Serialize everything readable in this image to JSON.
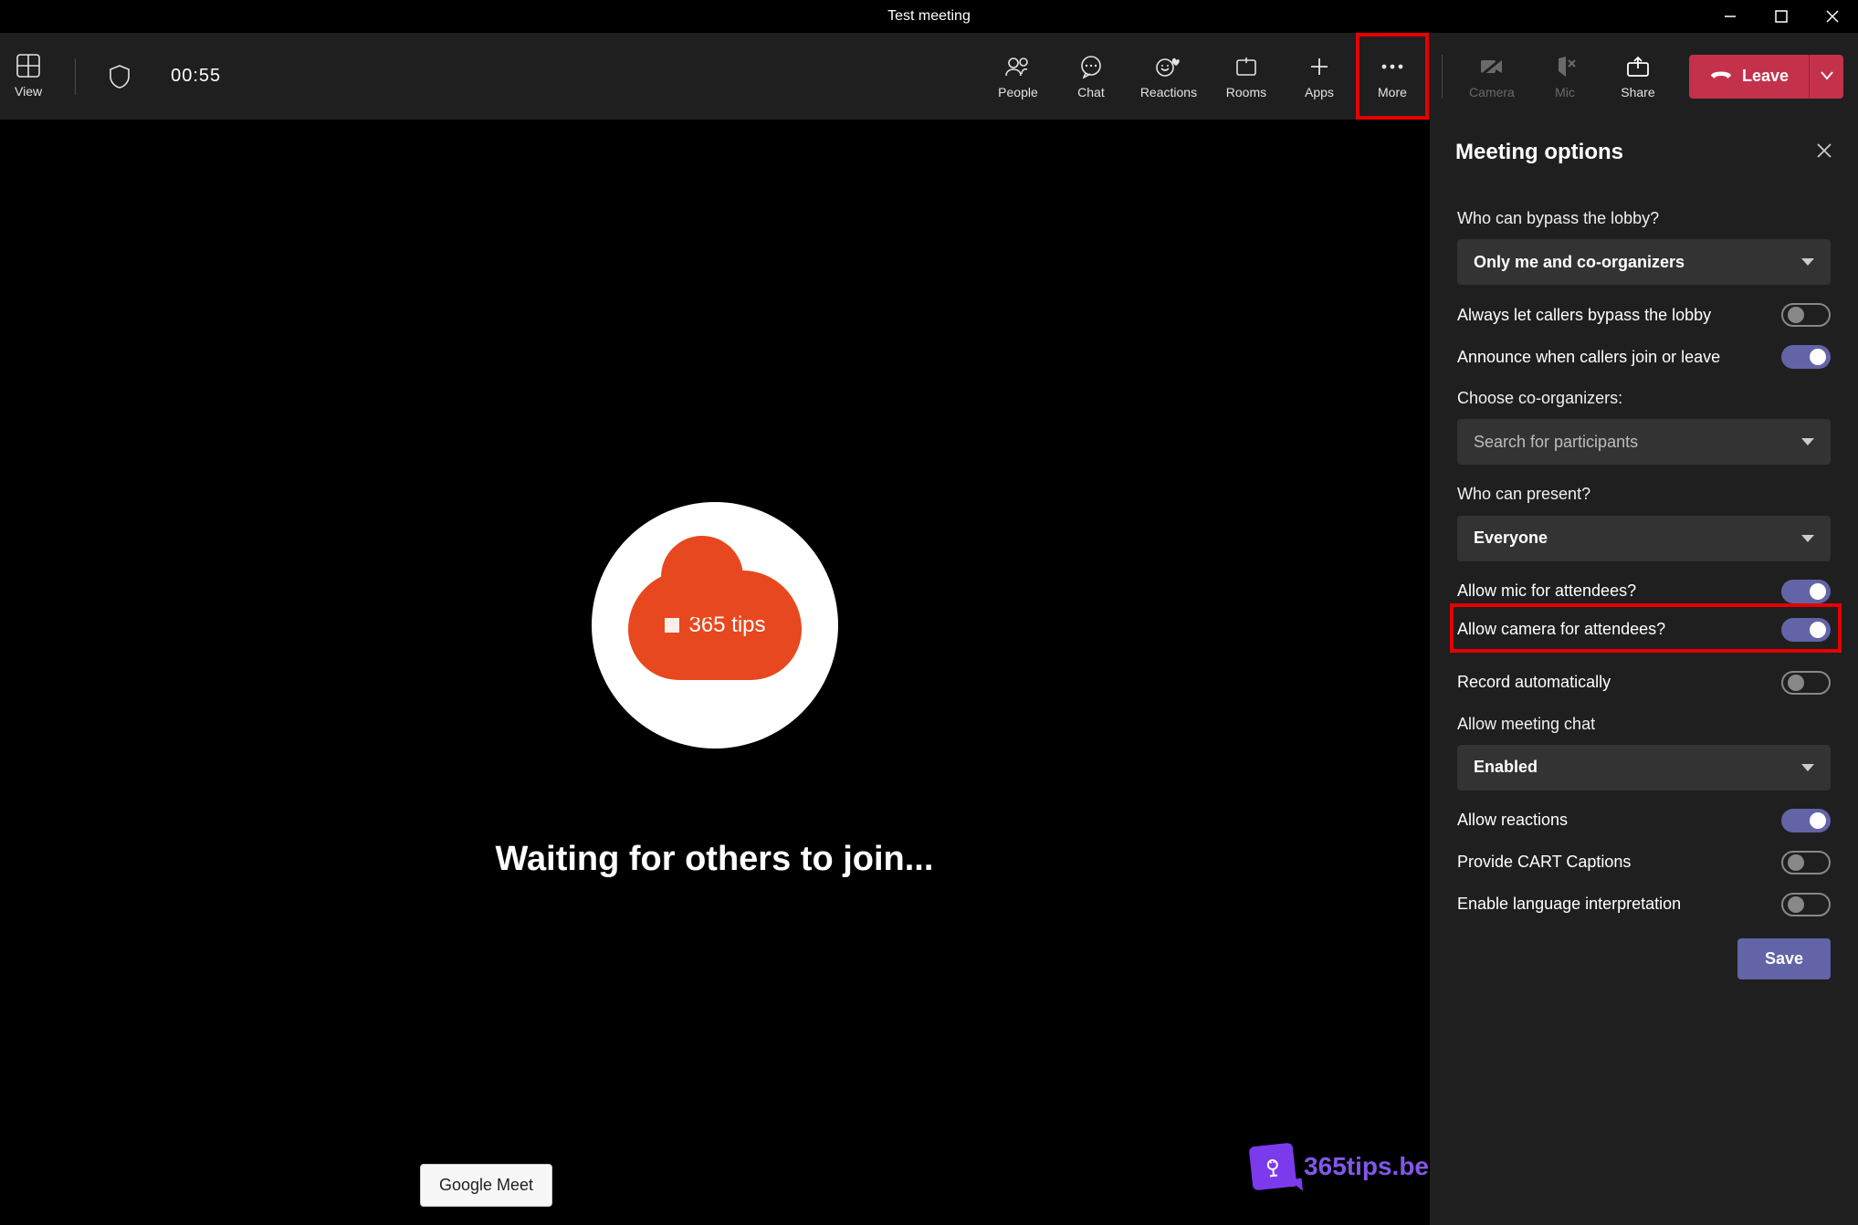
{
  "window": {
    "title": "Test meeting"
  },
  "topbar": {
    "view": "View",
    "timer": "00:55",
    "tools": {
      "people": "People",
      "chat": "Chat",
      "reactions": "Reactions",
      "rooms": "Rooms",
      "apps": "Apps",
      "more": "More",
      "camera": "Camera",
      "mic": "Mic",
      "share": "Share"
    },
    "leave": "Leave"
  },
  "stage": {
    "avatar_text": "365 tips",
    "waiting": "Waiting for others to join...",
    "google_meet": "Google Meet"
  },
  "panel": {
    "title": "Meeting options",
    "lobby_label": "Who can bypass the lobby?",
    "lobby_value": "Only me and co-organizers",
    "callers_bypass": {
      "label": "Always let callers bypass the lobby",
      "on": false
    },
    "announce": {
      "label": "Announce when callers join or leave",
      "on": true
    },
    "coorganizers_label": "Choose co-organizers:",
    "coorganizers_placeholder": "Search for participants",
    "present_label": "Who can present?",
    "present_value": "Everyone",
    "allow_mic": {
      "label": "Allow mic for attendees?",
      "on": true
    },
    "allow_cam": {
      "label": "Allow camera for attendees?",
      "on": true
    },
    "record_auto": {
      "label": "Record automatically",
      "on": false
    },
    "chat_label": "Allow meeting chat",
    "chat_value": "Enabled",
    "allow_reactions": {
      "label": "Allow reactions",
      "on": true
    },
    "cart": {
      "label": "Provide CART Captions",
      "on": false
    },
    "lang_interp": {
      "label": "Enable language interpretation",
      "on": false
    },
    "save": "Save"
  },
  "watermark": {
    "text": "365tips.be"
  }
}
